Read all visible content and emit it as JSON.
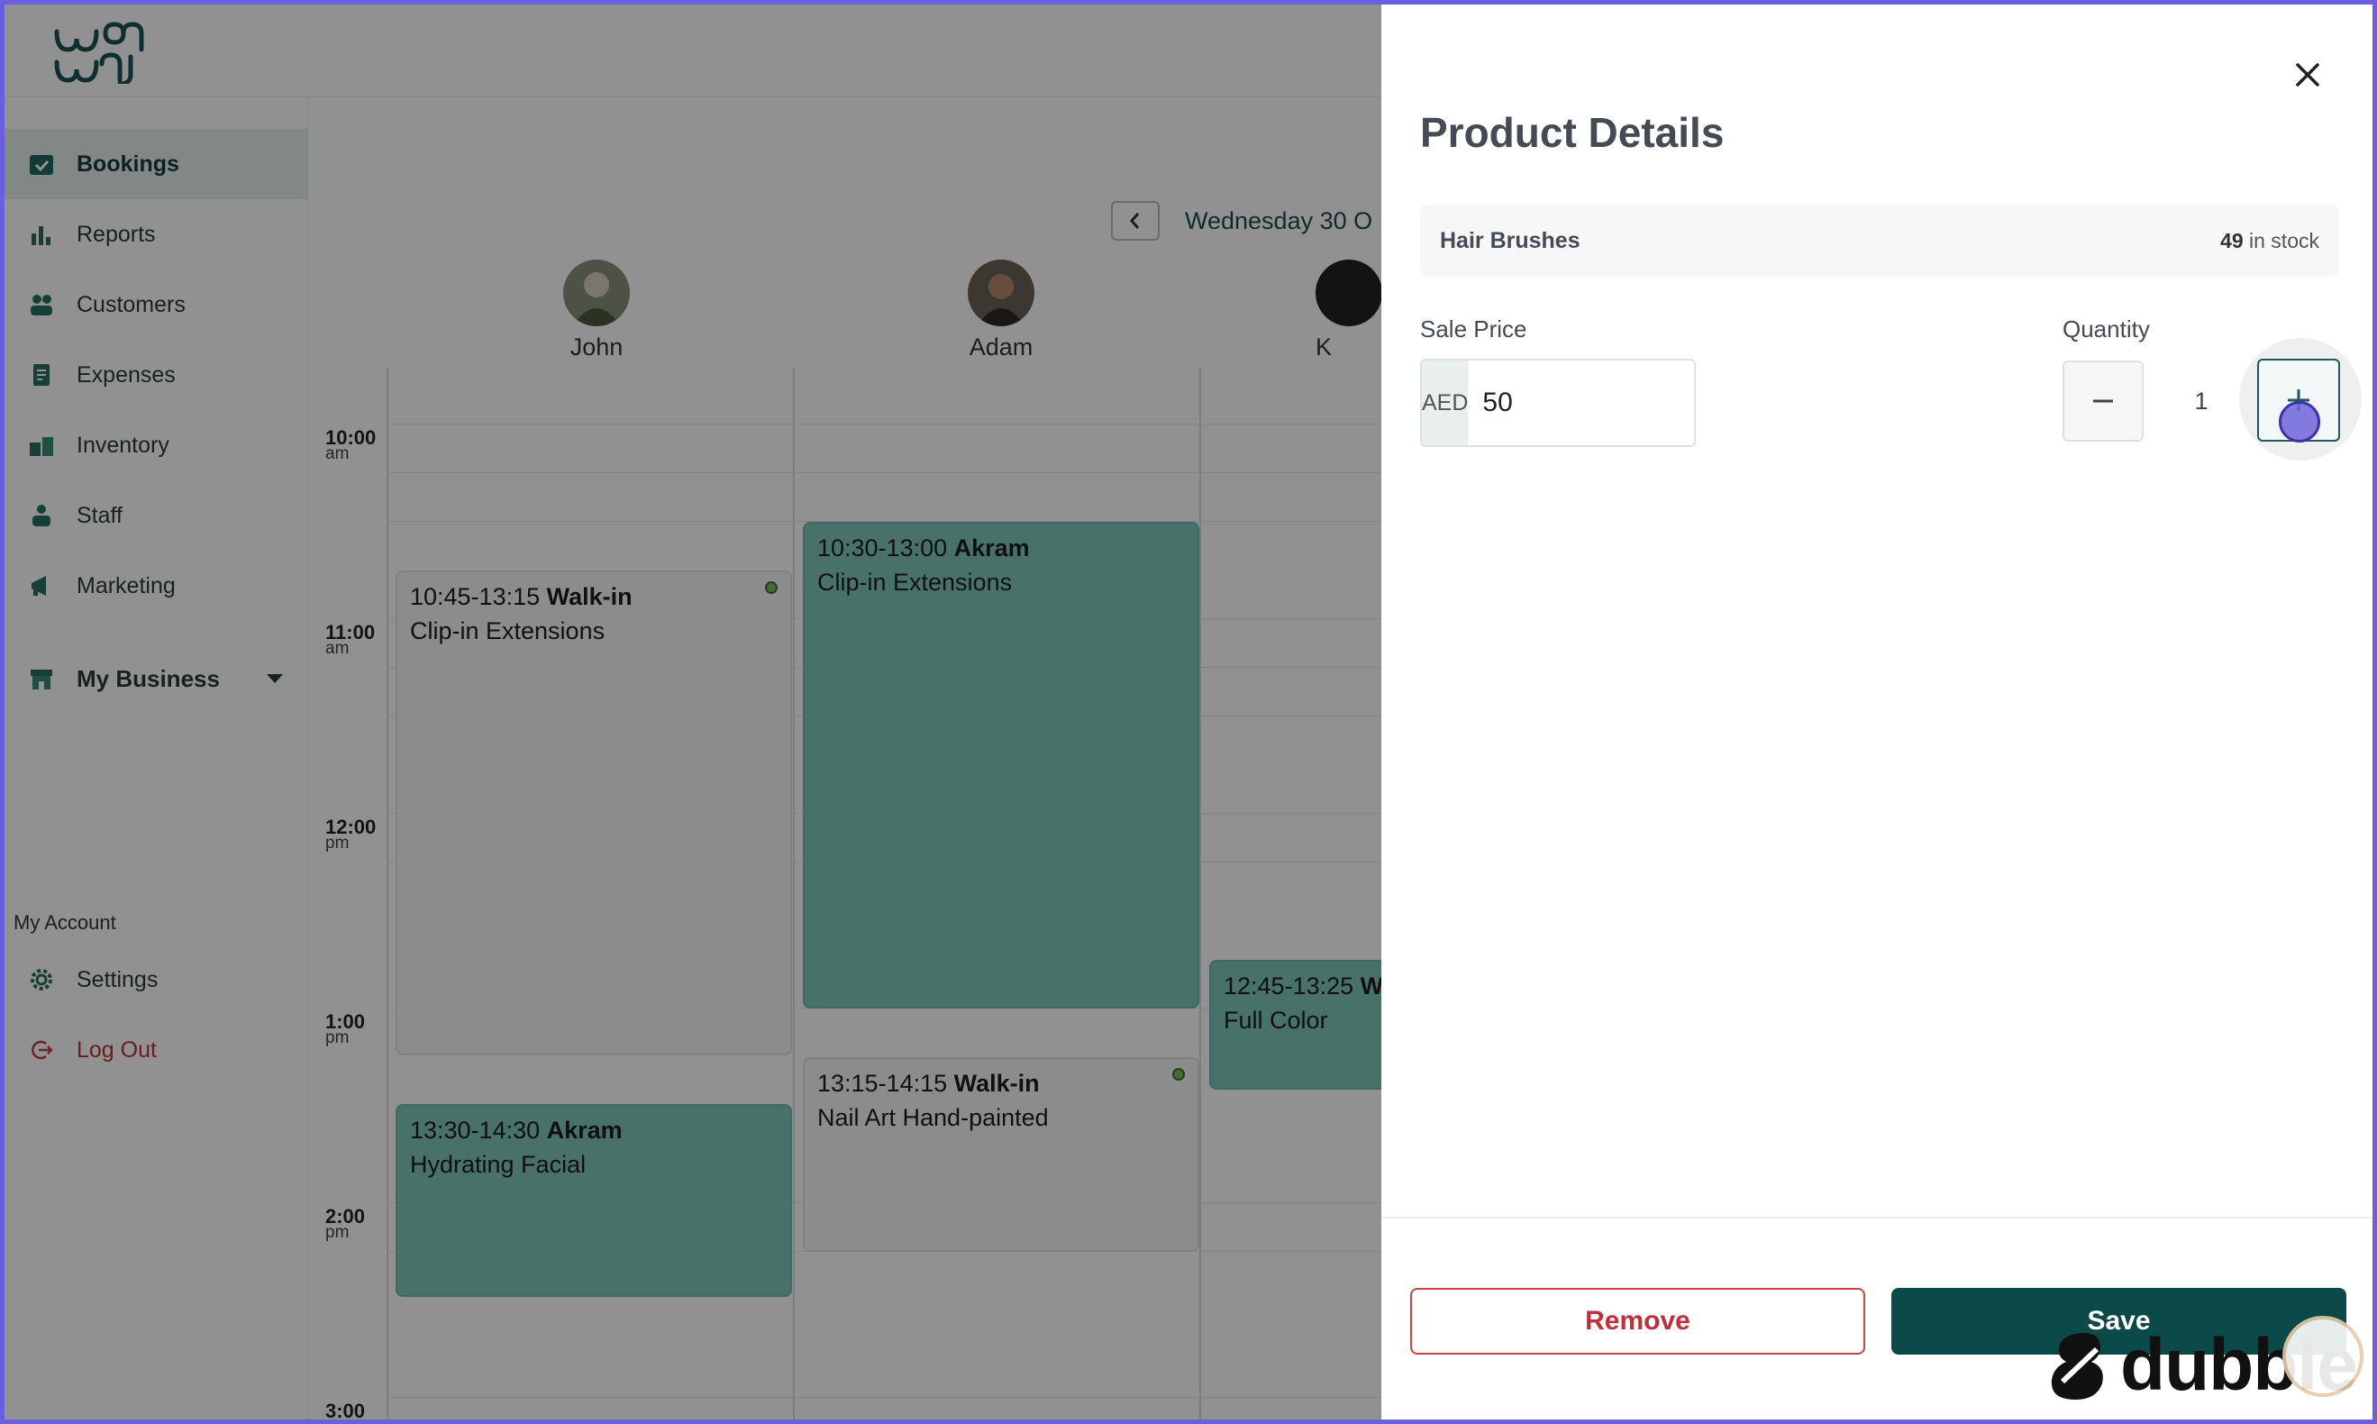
{
  "app": {
    "nav": [
      {
        "label": "Bookings",
        "icon": "calendar-icon",
        "active": true
      },
      {
        "label": "Reports",
        "icon": "bar-chart-icon"
      },
      {
        "label": "Customers",
        "icon": "users-icon"
      },
      {
        "label": "Expenses",
        "icon": "receipt-icon"
      },
      {
        "label": "Inventory",
        "icon": "boxes-icon"
      },
      {
        "label": "Staff",
        "icon": "staff-icon"
      },
      {
        "label": "Marketing",
        "icon": "megaphone-icon"
      }
    ],
    "my_business": "My Business",
    "account_label": "My Account",
    "settings": "Settings",
    "logout": "Log Out",
    "date": "Wednesday 30 O",
    "staff": [
      "John",
      "Adam",
      "K"
    ],
    "times": [
      {
        "t": "10:00",
        "m": "am"
      },
      {
        "t": "11:00",
        "m": "am"
      },
      {
        "t": "12:00",
        "m": "pm"
      },
      {
        "t": "1:00",
        "m": "pm"
      },
      {
        "t": "2:00",
        "m": "pm"
      },
      {
        "t": "3:00",
        "m": ""
      }
    ],
    "events": [
      {
        "time": "10:45-13:15",
        "who": "Walk-in",
        "service": "Clip-in Extensions"
      },
      {
        "time": "10:30-13:00",
        "who": "Akram",
        "service": "Clip-in Extensions"
      },
      {
        "time": "12:45-13:25",
        "who": "W",
        "service": "Full Color"
      },
      {
        "time": "13:30-14:30",
        "who": "Akram",
        "service": "Hydrating Facial"
      },
      {
        "time": "13:15-14:15",
        "who": "Walk-in",
        "service": "Nail Art Hand-painted"
      }
    ]
  },
  "drawer": {
    "title": "Product Details",
    "product_name": "Hair Brushes",
    "stock_count": "49",
    "stock_suffix": " in stock",
    "sale_price_label": "Sale Price",
    "currency": "AED",
    "price": "50",
    "quantity_label": "Quantity",
    "quantity": "1",
    "remove_label": "Remove",
    "save_label": "Save"
  },
  "watermark": "dubble",
  "colors": {
    "primary": "#0c4a4a",
    "danger": "#c0303a",
    "event_teal": "#7fc7ba",
    "frame": "#6a5fe0"
  }
}
